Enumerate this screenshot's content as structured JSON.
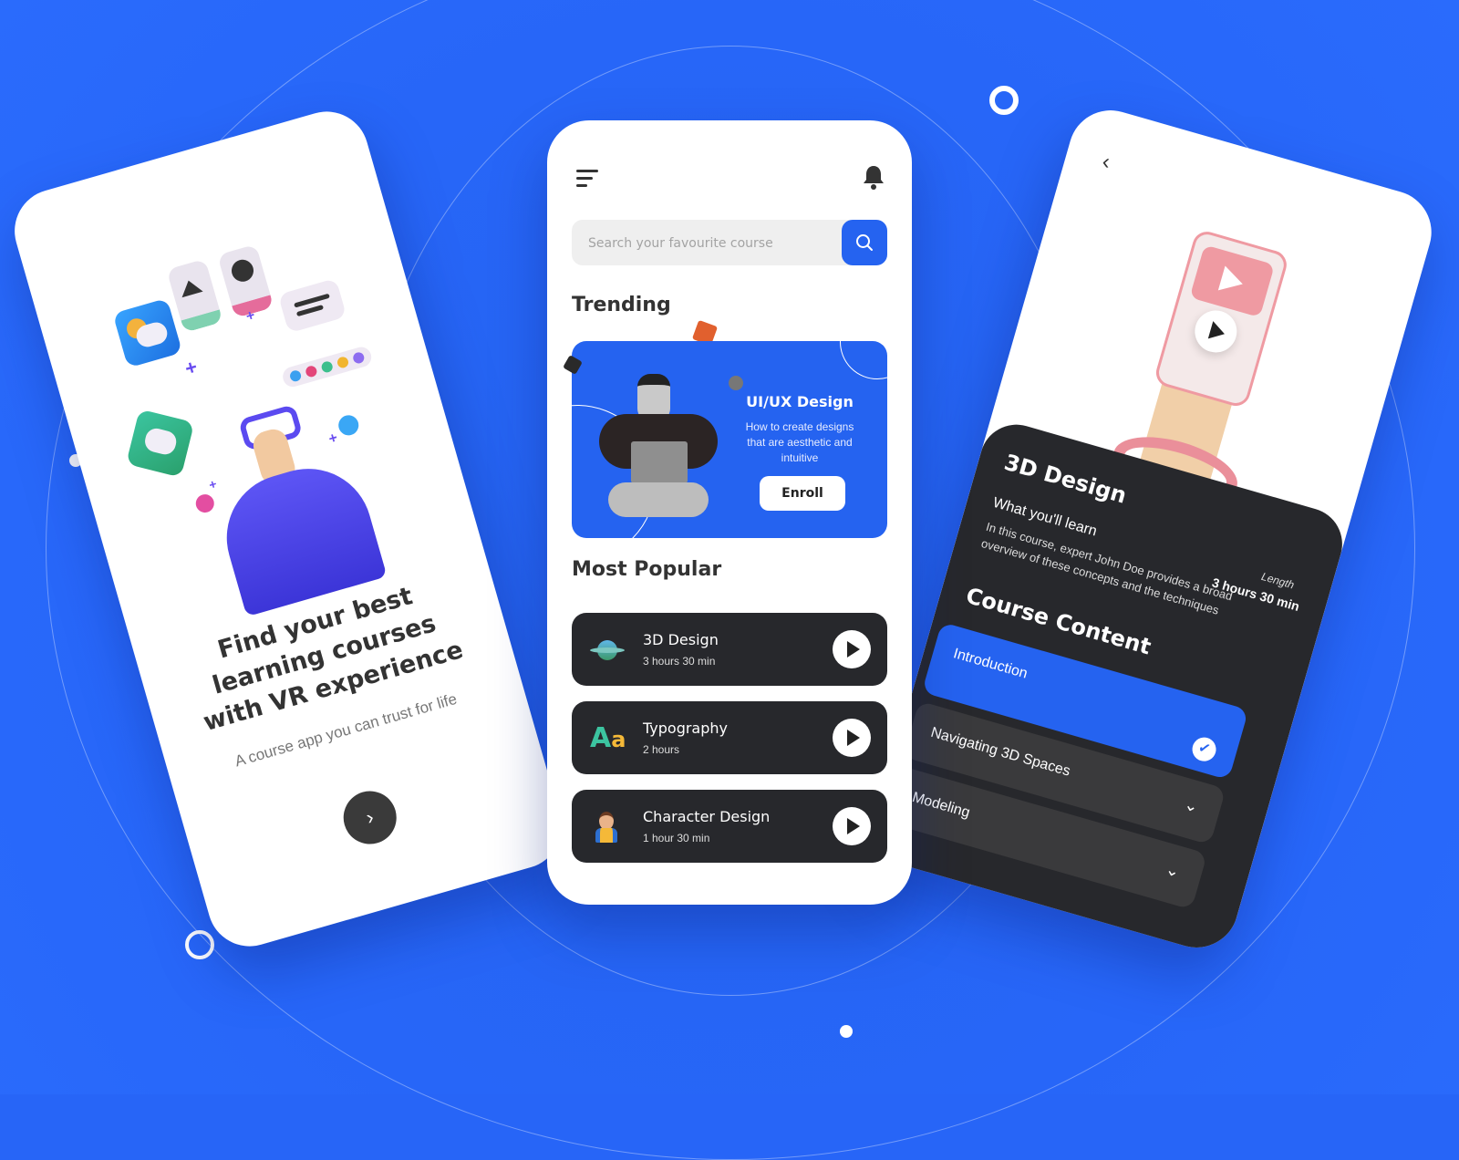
{
  "colors": {
    "background": "#2765f7",
    "accent": "#2563f0",
    "dark_card": "#27282c",
    "text_dark": "#333333"
  },
  "onboarding": {
    "headline_lines": [
      "Find your best",
      "learning courses",
      "with VR experience"
    ],
    "subtitle": "A course app you can trust for life",
    "next_icon": "chevron-right-icon",
    "illustration_icons": [
      "weather-app-icon",
      "image-card-icon",
      "video-card-icon",
      "palette-card-icon",
      "color-swatch-icon",
      "chat-bubble-icon",
      "vr-person-illustration"
    ]
  },
  "home": {
    "menu_icon": "hamburger-menu-icon",
    "bell_icon": "notification-bell-icon",
    "search": {
      "placeholder": "Search your favourite course",
      "value": "",
      "button_icon": "search-icon"
    },
    "trending": {
      "title": "Trending",
      "card": {
        "title": "UI/UX Design",
        "description": "How to create designs that are aesthetic and intuitive",
        "button": "Enroll"
      }
    },
    "popular": {
      "title": "Most Popular",
      "courses": [
        {
          "name": "3D Design",
          "duration": "3 hours 30 min",
          "icon": "planet-icon"
        },
        {
          "name": "Typography",
          "duration": "2 hours",
          "icon": "typography-aa-icon"
        },
        {
          "name": "Character Design",
          "duration": "1 hour 30 min",
          "icon": "character-avatar-icon"
        }
      ]
    }
  },
  "detail": {
    "back_icon": "chevron-left-icon",
    "title": "3D Design",
    "length_label": "Length",
    "length_value": "3 hours 30 min",
    "learn_title": "What you'll learn",
    "description": "In this course, expert John Doe provides a broad overview of these concepts and the techniques",
    "content_title": "Course Content",
    "lessons": [
      {
        "label": "Introduction",
        "state": "completed"
      },
      {
        "label": "Navigating 3D Spaces",
        "state": "collapsed"
      },
      {
        "label": "Modeling",
        "state": "collapsed"
      }
    ]
  }
}
